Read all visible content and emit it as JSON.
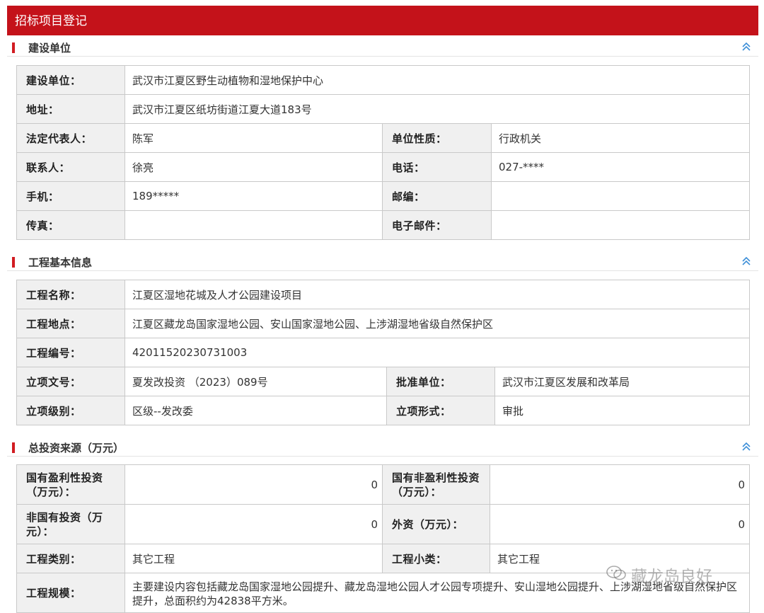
{
  "page": {
    "title": "招标项目登记"
  },
  "sections": {
    "builder": {
      "title": "建设单位",
      "fields": {
        "unit_label": "建设单位：",
        "unit_value": "武汉市江夏区野生动植物和湿地保护中心",
        "address_label": "地址：",
        "address_value": "武汉市江夏区纸坊街道江夏大道183号",
        "legal_rep_label": "法定代表人：",
        "legal_rep_value": "陈军",
        "nature_label": "单位性质：",
        "nature_value": "行政机关",
        "contact_label": "联系人：",
        "contact_value": "徐亮",
        "phone_label": "电话：",
        "phone_value": "027-****",
        "mobile_label": "手机：",
        "mobile_value": "189*****",
        "postcode_label": "邮编：",
        "postcode_value": "",
        "fax_label": "传真：",
        "fax_value": "",
        "email_label": "电子邮件：",
        "email_value": ""
      }
    },
    "project": {
      "title": "工程基本信息",
      "fields": {
        "name_label": "工程名称：",
        "name_value": "江夏区湿地花城及人才公园建设项目",
        "location_label": "工程地点：",
        "location_value": "江夏区藏龙岛国家湿地公园、安山国家湿地公园、上涉湖湿地省级自然保护区",
        "code_label": "工程编号：",
        "code_value": "42011520230731003",
        "doc_label": "立项文号：",
        "doc_value": "夏发改投资 （2023）089号",
        "approver_label": "批准单位：",
        "approver_value": "武汉市江夏区发展和改革局",
        "level_label": "立项级别：",
        "level_value": "区级--发改委",
        "form_label": "立项形式：",
        "form_value": "审批"
      }
    },
    "investment": {
      "title": "总投资来源（万元）",
      "fields": {
        "state_profit_label": "国有盈利性投资（万元）：",
        "state_profit_value": "0",
        "state_nonprofit_label": "国有非盈利性投资（万元）：",
        "state_nonprofit_value": "0",
        "nonstate_label": "非国有投资（万元）：",
        "nonstate_value": "0",
        "foreign_label": "外资（万元）：",
        "foreign_value": "0",
        "category_label": "工程类别：",
        "category_value": "其它工程",
        "subcategory_label": "工程小类：",
        "subcategory_value": "其它工程",
        "scale_label": "工程规模：",
        "scale_value": "主要建设内容包括藏龙岛国家湿地公园提升、藏龙岛湿地公园人才公园专项提升、安山湿地公园提升、上涉湖湿地省级自然保护区提升，总面积约为42838平方米。"
      }
    }
  },
  "watermark": {
    "text": "藏龙岛良好"
  },
  "icons": {
    "collapse": "double-chevron-up-icon",
    "watermark": "wechat-icon"
  },
  "colors": {
    "header_red": "#c4121a",
    "marker_red": "#d11c22",
    "label_bg": "#f0f0f0",
    "link_blue": "#3d8fd8"
  }
}
